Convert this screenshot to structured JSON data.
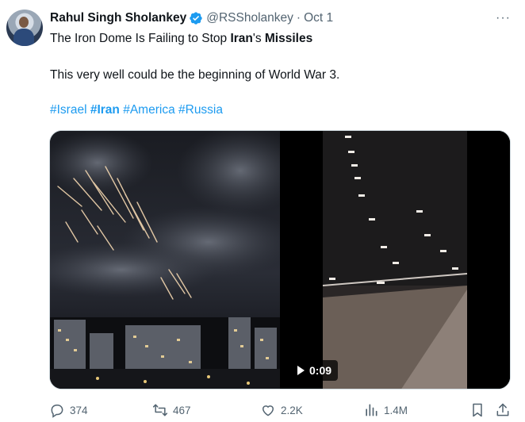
{
  "tweet": {
    "author_name": "Rahul Singh Sholankey",
    "handle": "@RSSholankey",
    "separator": "·",
    "date": "Oct 1",
    "more_label": "···",
    "line1": {
      "p1": "The Iron Dome Is Failing to Stop ",
      "p2": "Iran",
      "p3": "'s ",
      "p4": "Missiles"
    },
    "line2": "This very well could be the beginning of World War 3.",
    "hashtags": [
      "#Israel",
      "#Iran",
      "#America",
      "#Russia"
    ]
  },
  "media": {
    "video_duration": "0:09"
  },
  "actions": {
    "replies": "374",
    "retweets": "467",
    "likes": "2.2K",
    "views": "1.4M"
  },
  "colors": {
    "accent": "#1d9bf0",
    "secondary_text": "#536471",
    "border": "#cfd9de"
  }
}
